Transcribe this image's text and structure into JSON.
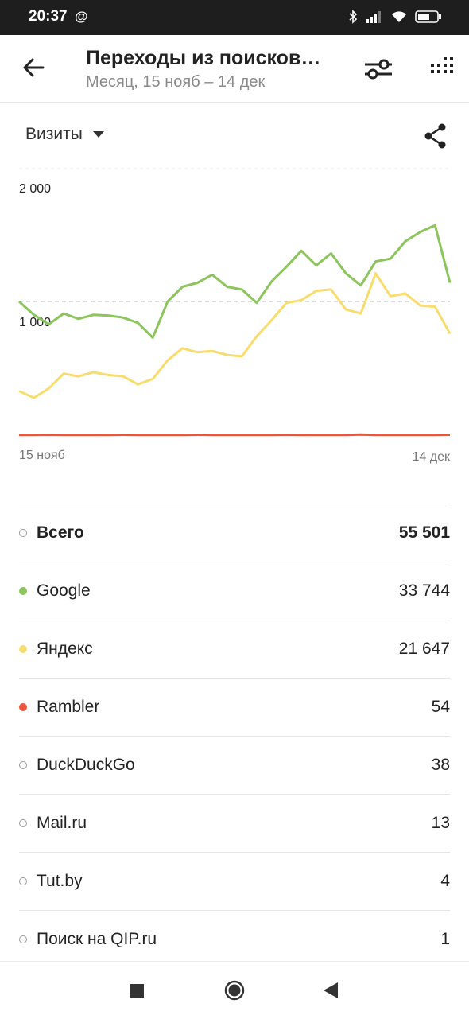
{
  "status_bar": {
    "time": "20:37",
    "at_symbol": "@"
  },
  "header": {
    "title": "Переходы из поисков…",
    "subtitle": "Месяц, 15 нояб – 14 дек"
  },
  "metric_selector": {
    "label": "Визиты"
  },
  "icons": {
    "back": "arrow-left-icon",
    "filter": "sliders-icon",
    "grid": "dots-grid-icon",
    "share": "share-icon",
    "dropdown": "caret-down-icon"
  },
  "colors": {
    "google": "#8cc55b",
    "yandex": "#f9dc6e",
    "rambler": "#f0553c",
    "neutral_dot": "#9b9b9b"
  },
  "chart_data": {
    "type": "line",
    "y_ticks": [
      "2 000",
      "1 000"
    ],
    "x_tick_labels": [
      "15 нояб",
      "14 дек"
    ],
    "ylim": [
      0,
      2200
    ],
    "reference_line": 1000,
    "series": [
      {
        "name": "Google",
        "color": "#8cc55b",
        "values": [
          1000,
          900,
          830,
          910,
          870,
          900,
          895,
          880,
          840,
          730,
          1000,
          1110,
          1140,
          1200,
          1110,
          1090,
          990,
          1150,
          1260,
          1380,
          1270,
          1360,
          1210,
          1120,
          1300,
          1320,
          1450,
          1520,
          1570,
          1140
        ]
      },
      {
        "name": "Яндекс",
        "color": "#f9dc6e",
        "values": [
          330,
          280,
          350,
          460,
          440,
          470,
          450,
          440,
          380,
          420,
          560,
          650,
          620,
          630,
          600,
          590,
          740,
          860,
          990,
          1010,
          1080,
          1090,
          940,
          910,
          1210,
          1040,
          1060,
          970,
          960,
          760
        ]
      },
      {
        "name": "Rambler",
        "color": "#f0553c",
        "values": [
          2,
          1,
          3,
          2,
          2,
          1,
          2,
          3,
          2,
          1,
          2,
          2,
          3,
          2,
          1,
          2,
          2,
          2,
          3,
          1,
          2,
          2,
          1,
          4,
          2,
          2,
          1,
          2,
          2,
          3
        ]
      }
    ]
  },
  "table": {
    "rows": [
      {
        "name": "Всего",
        "value": "55 501",
        "dot": "hollow"
      },
      {
        "name": "Google",
        "value": "33 744",
        "dot": "#8cc55b"
      },
      {
        "name": "Яндекс",
        "value": "21 647",
        "dot": "#f9dc6e"
      },
      {
        "name": "Rambler",
        "value": "54",
        "dot": "#f0553c"
      },
      {
        "name": "DuckDuckGo",
        "value": "38",
        "dot": "hollow"
      },
      {
        "name": "Mail.ru",
        "value": "13",
        "dot": "hollow"
      },
      {
        "name": "Tut.by",
        "value": "4",
        "dot": "hollow"
      },
      {
        "name": "Поиск на QIP.ru",
        "value": "1",
        "dot": "hollow"
      }
    ]
  }
}
